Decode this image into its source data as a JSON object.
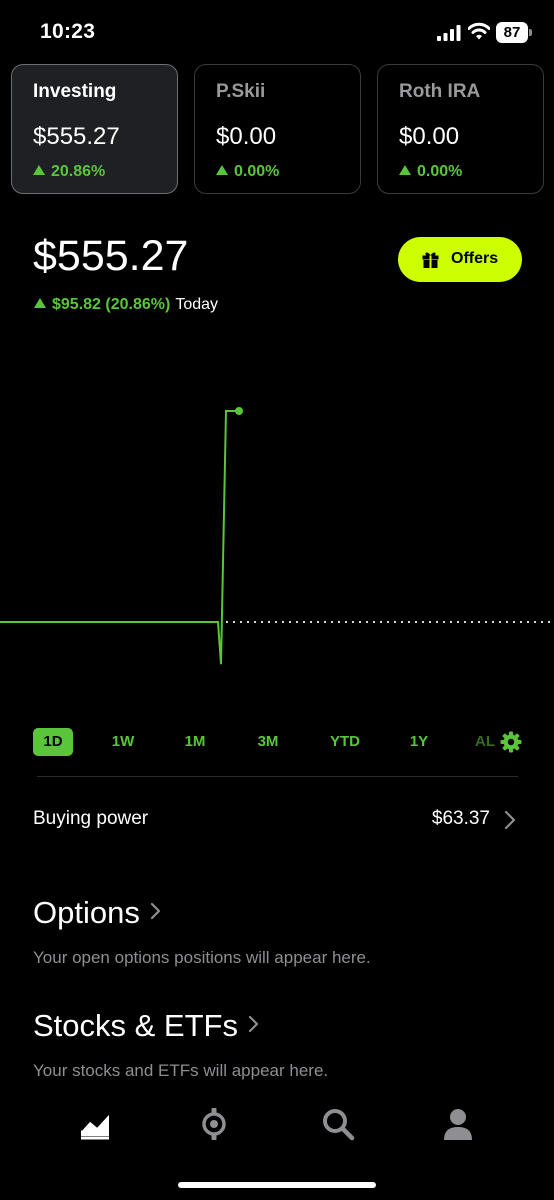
{
  "status_bar": {
    "time": "10:23",
    "battery": "87"
  },
  "accounts": [
    {
      "name": "Investing",
      "value": "$555.27",
      "change": "20.86%",
      "active": true
    },
    {
      "name": "P.Skii",
      "value": "$0.00",
      "change": "0.00%",
      "active": false
    },
    {
      "name": "Roth IRA",
      "value": "$0.00",
      "change": "0.00%",
      "active": false
    }
  ],
  "portfolio": {
    "value": "$555.27",
    "change_amount": "$95.82 (20.86%)",
    "change_label": "Today",
    "offers_label": "Offers"
  },
  "colors": {
    "positive": "#5ac53a",
    "accent": "#ccff00",
    "background": "#000000"
  },
  "chart_data": {
    "type": "line",
    "baseline": "previous close (dotted)",
    "series": [
      {
        "values": [
          0,
          0,
          0,
          0,
          0,
          0,
          0,
          -0.2,
          1.0,
          1.0
        ]
      }
    ],
    "end_marker": true
  },
  "ranges": [
    {
      "label": "1D",
      "active": true
    },
    {
      "label": "1W",
      "active": false
    },
    {
      "label": "1M",
      "active": false
    },
    {
      "label": "3M",
      "active": false
    },
    {
      "label": "YTD",
      "active": false
    },
    {
      "label": "1Y",
      "active": false
    },
    {
      "label": "AL",
      "active": false
    }
  ],
  "buying_power": {
    "label": "Buying power",
    "value": "$63.37"
  },
  "options": {
    "title": "Options",
    "subtitle": "Your open options positions will appear here."
  },
  "stocks": {
    "title": "Stocks & ETFs",
    "subtitle": "Your stocks and ETFs will appear here."
  },
  "tabs": [
    {
      "icon": "chart-trend-icon",
      "active": true
    },
    {
      "icon": "crypto-icon",
      "active": false
    },
    {
      "icon": "search-icon",
      "active": false
    },
    {
      "icon": "profile-icon",
      "active": false
    }
  ]
}
